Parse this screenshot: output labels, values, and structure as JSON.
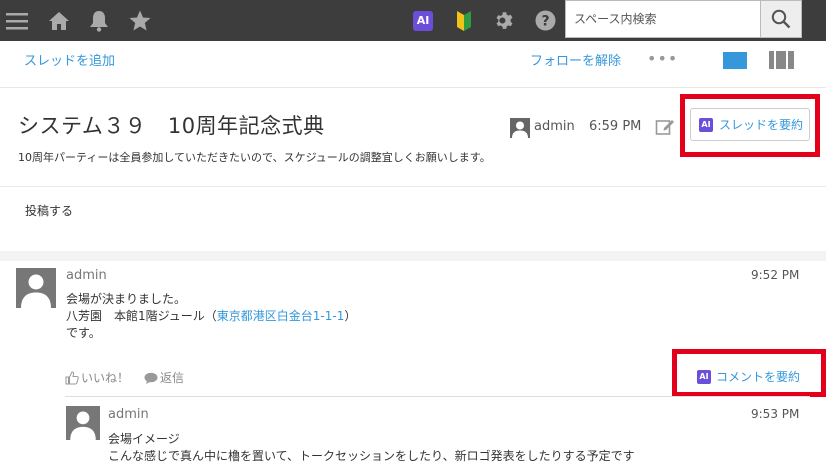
{
  "header": {
    "search_placeholder": "スペース内検索",
    "ai_badge": "AI"
  },
  "toolbar": {
    "add_thread": "スレッドを追加",
    "unfollow": "フォローを解除",
    "more": "•••"
  },
  "thread": {
    "title": "システム３９　10周年記念式典",
    "description": "10周年パーティーは全員参加していただきたいので、スケジュールの調整宜しくお願いします。",
    "author": "admin",
    "time": "6:59 PM",
    "summarize_label": "スレッドを要約"
  },
  "post": {
    "label": "投稿する"
  },
  "comments": [
    {
      "author": "admin",
      "time": "9:52 PM",
      "line1": "会場が決まりました。",
      "line2_prefix": "八芳園　本館1階ジュール（",
      "line2_address": "東京都港区白金台1-1-1",
      "line2_suffix": "）",
      "line3": "です。",
      "like_label": "いいね！",
      "reply_label": "返信",
      "summarize_label": "コメントを要約"
    },
    {
      "author": "admin",
      "time": "9:53 PM",
      "line1": "会場イメージ",
      "line2": "こんな感じで真ん中に櫓を置いて、トークセッションをしたり、新ロゴ発表をしたりする予定です"
    }
  ],
  "colors": {
    "topbar": "#3d3d3d",
    "link": "#3498db",
    "highlight": "#e3001b",
    "ai": "#6b4fd8"
  }
}
